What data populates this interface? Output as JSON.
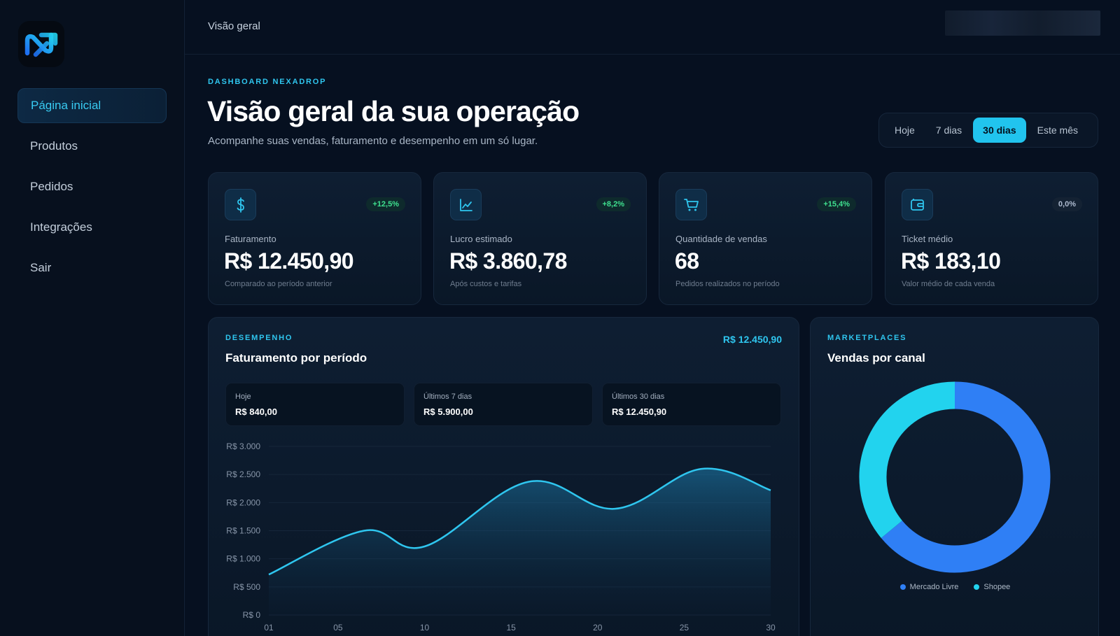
{
  "sidebar": {
    "items": [
      {
        "label": "Página inicial",
        "active": true
      },
      {
        "label": "Produtos"
      },
      {
        "label": "Pedidos"
      },
      {
        "label": "Integrações"
      },
      {
        "label": "Sair"
      }
    ]
  },
  "topbar": {
    "title": "Visão geral"
  },
  "header": {
    "eyebrow": "DASHBOARD NEXADROP",
    "title": "Visão geral da sua operação",
    "subtitle": "Acompanhe suas vendas, faturamento e desempenho em um só lugar."
  },
  "period": {
    "options": [
      "Hoje",
      "7 dias",
      "30 dias",
      "Este mês"
    ],
    "selected": "30 dias"
  },
  "kpis": [
    {
      "icon": "dollar-icon",
      "badge": "+12,5%",
      "label": "Faturamento",
      "value": "R$ 12.450,90",
      "note": "Comparado ao período anterior"
    },
    {
      "icon": "trend-chart-icon",
      "badge": "+8,2%",
      "label": "Lucro estimado",
      "value": "R$ 3.860,78",
      "note": "Após custos e tarifas"
    },
    {
      "icon": "cart-icon",
      "badge": "+15,4%",
      "label": "Quantidade de vendas",
      "value": "68",
      "note": "Pedidos realizados no período"
    },
    {
      "icon": "wallet-icon",
      "badge": "0,0%",
      "label": "Ticket médio",
      "value": "R$ 183,10",
      "note": "Valor médio de cada venda"
    }
  ],
  "performance": {
    "eyebrow": "DESEMPENHO",
    "title": "Faturamento por período",
    "total": "R$ 12.450,90",
    "summaries": [
      {
        "label": "Hoje",
        "value": "R$ 840,00"
      },
      {
        "label": "Últimos 7 dias",
        "value": "R$ 5.900,00"
      },
      {
        "label": "Últimos 30 dias",
        "value": "R$ 12.450,90"
      }
    ]
  },
  "marketplaces": {
    "eyebrow": "MARKETPLACES",
    "title": "Vendas por canal"
  },
  "colors": {
    "accent": "#2fc6ef",
    "mercado_livre": "#2f7ff5",
    "shopee": "#22d3ee",
    "positive": "#3fe08f"
  },
  "chart_data": [
    {
      "type": "area",
      "title": "Faturamento por período",
      "y_tick_labels": [
        "R$ 3.000",
        "R$ 2.500",
        "R$ 2.000",
        "R$ 1.500",
        "R$ 1.000",
        "R$ 500",
        "R$ 0"
      ],
      "y_ticks": [
        3000,
        2500,
        2000,
        1500,
        1000,
        500,
        0
      ],
      "x_tick_labels": [
        "01",
        "05",
        "10",
        "15",
        "20",
        "25",
        "30"
      ],
      "x_ticks": [
        1,
        5,
        10,
        15,
        20,
        25,
        30
      ],
      "ylim": [
        0,
        3000
      ],
      "xlim": [
        1,
        30
      ],
      "x": [
        1,
        6.5,
        10,
        16,
        21,
        26,
        30
      ],
      "values": [
        720,
        1500,
        1220,
        2370,
        1890,
        2600,
        2220
      ],
      "grid": true
    },
    {
      "type": "pie",
      "title": "Vendas por canal",
      "labels": [
        "Mercado Livre",
        "Shopee"
      ],
      "values": [
        64,
        36
      ],
      "legend": "bottom-center"
    }
  ]
}
